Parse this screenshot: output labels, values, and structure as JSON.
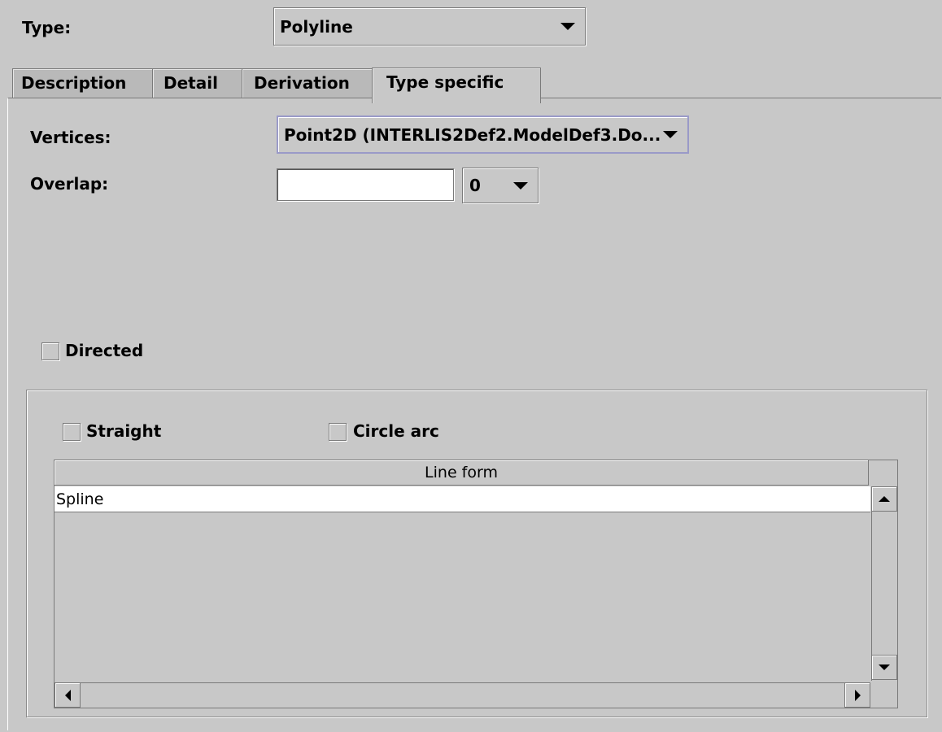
{
  "type_row": {
    "label": "Type:",
    "value": "Polyline"
  },
  "tabs": [
    {
      "label": "Description",
      "selected": false
    },
    {
      "label": "Detail",
      "selected": false
    },
    {
      "label": "Derivation",
      "selected": false
    },
    {
      "label": "Type specific",
      "selected": true
    }
  ],
  "vertices": {
    "label": "Vertices:",
    "value": "Point2D (INTERLIS2Def2.ModelDef3.Do..."
  },
  "overlap": {
    "label": "Overlap:",
    "text_value": "",
    "unit_value": "0"
  },
  "directed": {
    "label": "Directed",
    "checked": false
  },
  "line_forms": {
    "straight_label": "Straight",
    "straight_checked": false,
    "circle_arc_label": "Circle arc",
    "circle_arc_checked": false,
    "table": {
      "column_header": "Line form",
      "rows": [
        "Spline"
      ]
    }
  },
  "icons": {
    "dropdown": "chevron-down-icon",
    "scroll_up": "arrow-up-icon",
    "scroll_down": "arrow-down-icon",
    "scroll_left": "arrow-left-icon",
    "scroll_right": "arrow-right-icon"
  },
  "colors": {
    "background": "#c8c8c8",
    "focus_border": "#9a9ac8",
    "field_background": "#ffffff"
  }
}
